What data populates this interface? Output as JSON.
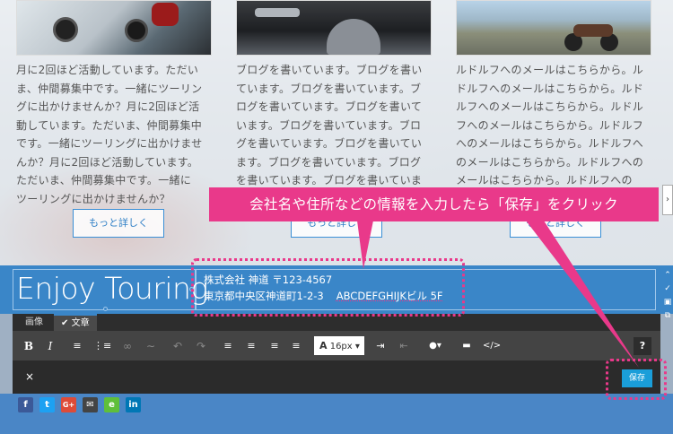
{
  "columns": [
    {
      "text": "月に2回ほど活動しています。ただい\nま、仲間募集中です。一緒にツーリン\nグに出かけませんか？月に2回ほど活\n動しています。ただいま、仲間募集中\nです。一緒にツーリングに出かけませ\nんか？月に2回ほど活動しています。\nただいま、仲間募集中です。一緒に\nツーリングに出かけませんか？",
      "button": "もっと詳しく"
    },
    {
      "text": "ブログを書いています。ブログを書い\nています。ブログを書いています。ブ\nログを書いています。ブログを書いて\nいます。ブログを書いています。ブロ\nグを書いています。ブログを書いてい\nます。ブログを書いています。ブログ\nを書いています。ブログを書いていま",
      "button": "もっと詳しく"
    },
    {
      "text": "ルドルフへのメールはこちらから。ル\nドルフへのメールはこちらから。ルド\nルフへのメールはこちらから。ルドル\nフへのメールはこちらから。ルドルフ\nへのメールはこちらから。ルドルフへ\nのメールはこちらから。ルドルフへの\nメールはこちらから。ルドルフへの",
      "button": "もっと詳しく"
    }
  ],
  "header": {
    "logo": "Enjoy Touring",
    "address_line1": "株式会社 神道 〒123-4567",
    "address_line2": "東京都中央区神道町1-2-3",
    "address_line2_suffix": "ABCDEFGHIJKビル 5F"
  },
  "editor": {
    "tabs": [
      "画像",
      "文章"
    ],
    "active_tab_check": "✔",
    "font_size": "16px",
    "close_label": "×",
    "save_label": "保存",
    "help_label": "?"
  },
  "callout": {
    "text": "会社名や住所などの情報を入力したら「保存」をクリック"
  },
  "social": [
    {
      "label": "f",
      "color": "#3b5998"
    },
    {
      "label": "t",
      "color": "#1da1f2"
    },
    {
      "label": "G+",
      "color": "#dd4b39"
    },
    {
      "label": "✉",
      "color": "#444444"
    },
    {
      "label": "e",
      "color": "#5fbf3a"
    },
    {
      "label": "in",
      "color": "#0077b5"
    }
  ],
  "colors": {
    "accent_pink": "#e9398a",
    "header_blue": "#3a86c8",
    "save_blue": "#1a9ed9"
  }
}
